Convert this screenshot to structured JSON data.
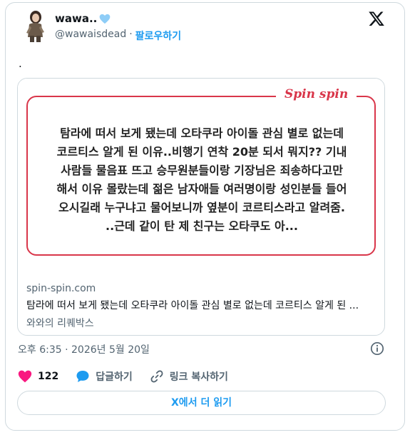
{
  "user": {
    "display_name": "wawa..",
    "handle": "@wawaisdead",
    "separator": "·",
    "follow_label": "팔로우하기"
  },
  "tweet": {
    "text": "."
  },
  "link_card": {
    "brand": "Spin spin",
    "excerpt": "탐라에 떠서 보게 됐는데 오타쿠라 아이돌 관심 별로 없는데\n코르티스 알게 된 이유..비행기 연착 20분 되서 뭐지?? 기내\n사람들 물음표 뜨고 승무원분들이랑 기장님은 죄송하다고만\n해서 이유 몰랐는데 젊은 남자애들 여러명이랑 성인분들 들어\n오시길래 누구냐고 물어보니까 옆분이 코르티스라고 알려줌.\n..근데 같이 탄 제 친구는 오타쿠도 아...",
    "domain": "spin-spin.com",
    "title": "탐라에 떠서 보게 됐는데 오타쿠라 아이돌 관심 별로 없는데 코르티스 알게 된 ...",
    "description": "와와의 리퀘박스"
  },
  "timestamp": "오후 6:35 · 2026년 5월 20일",
  "actions": {
    "like_count": "122",
    "reply_label": "답글하기",
    "copy_link_label": "링크 복사하기"
  },
  "read_more_label": "X에서 더 읽기",
  "colors": {
    "accent": "#1d9bf0",
    "like": "#f91880",
    "brand_red": "#d9364a",
    "border": "#cfd9de"
  }
}
